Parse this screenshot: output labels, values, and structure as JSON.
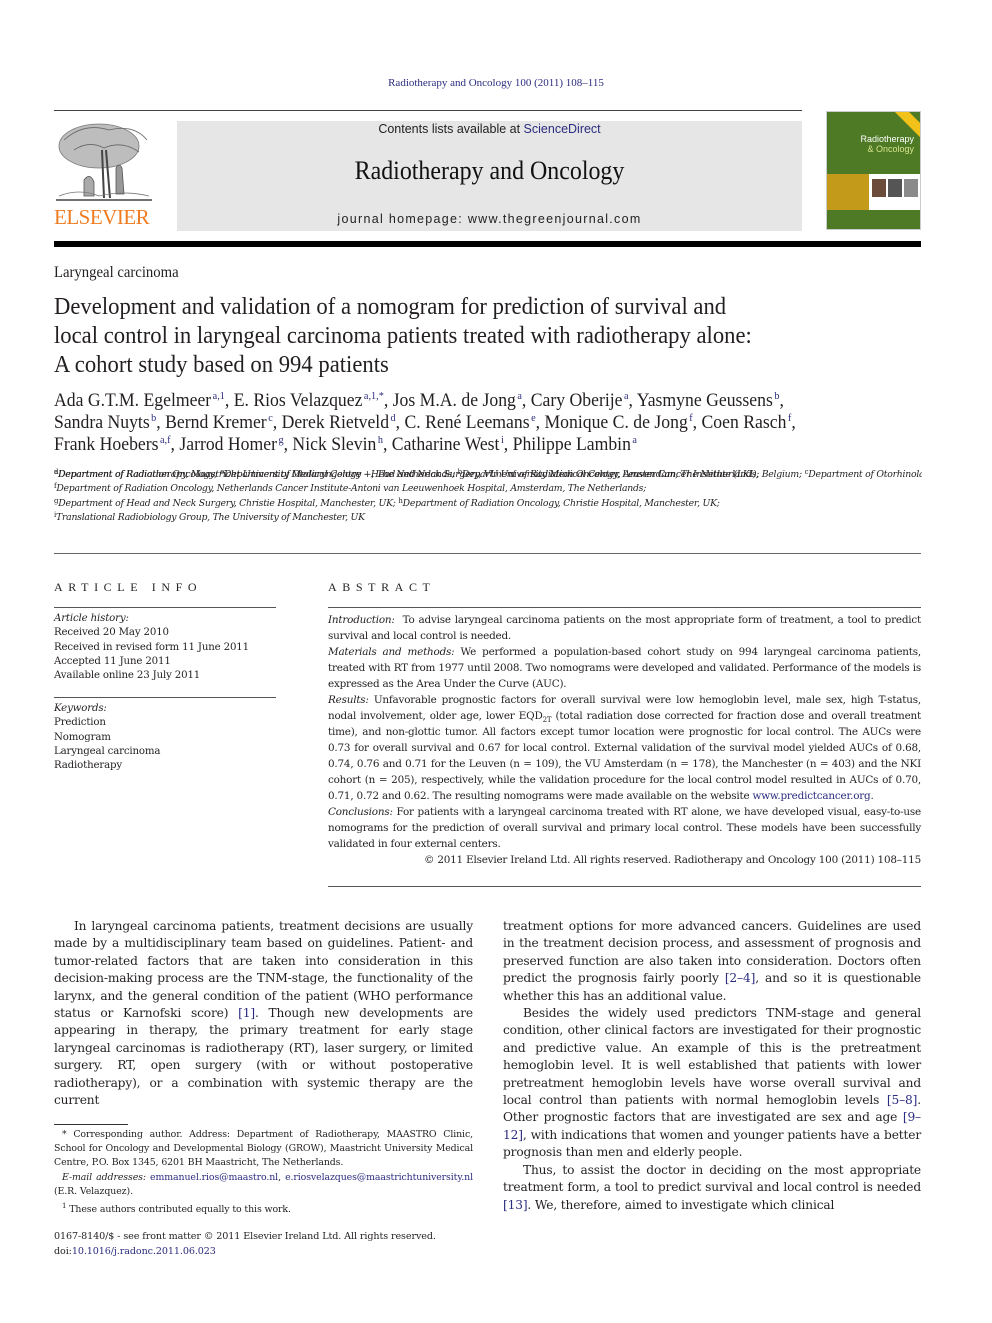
{
  "running_head": "Radiotherapy and Oncology 100 (2011) 108–115",
  "masthead": {
    "publisher_logo_text": "ELSEVIER",
    "contents_prefix": "Contents lists available at ",
    "contents_link": "ScienceDirect",
    "journal_name": "Radiotherapy and Oncology",
    "homepage_prefix": "journal homepage: ",
    "homepage_url": "www.thegreenjournal.com",
    "cover": {
      "title_line1": "Radiotherapy",
      "title_line2": "& Oncology",
      "colors": {
        "background": "#4e7a25",
        "band": "#c49a1a",
        "ribbon": "#f2c21b"
      }
    }
  },
  "colors": {
    "link": "#2b2c7f",
    "elsevier_orange": "#f07c22",
    "masthead_bg": "#e6e6e6"
  },
  "article": {
    "section": "Laryngeal carcinoma",
    "title_lines": [
      "Development and validation of a nomogram for prediction of survival and",
      "local control in laryngeal carcinoma patients treated with radiotherapy alone:",
      "A cohort study based on 994 patients"
    ],
    "authors": [
      {
        "name": "Ada G.T.M. Egelmeer",
        "sup": "a,1"
      },
      {
        "name": "E. Rios Velazquez",
        "sup": "a,1,*"
      },
      {
        "name": "Jos M.A. de Jong",
        "sup": "a"
      },
      {
        "name": "Cary Oberije",
        "sup": "a"
      },
      {
        "name": "Yasmyne Geussens",
        "sup": "b"
      },
      {
        "name": "Sandra Nuyts",
        "sup": "b"
      },
      {
        "name": "Bernd Kremer",
        "sup": "c"
      },
      {
        "name": "Derek Rietveld",
        "sup": "d"
      },
      {
        "name": "C. René Leemans",
        "sup": "e"
      },
      {
        "name": "Monique C. de Jong",
        "sup": "f"
      },
      {
        "name": "Coen Rasch",
        "sup": "f"
      },
      {
        "name": "Frank Hoebers",
        "sup": "a,f"
      },
      {
        "name": "Jarrod Homer",
        "sup": "g"
      },
      {
        "name": "Nick Slevin",
        "sup": "h"
      },
      {
        "name": "Catharine West",
        "sup": "i"
      },
      {
        "name": "Philippe Lambin",
        "sup": "a"
      }
    ],
    "affiliations": [
      {
        "key": "a",
        "text": "Department of Radiotherapy, Maastricht University Medical Centre +, The Netherlands;"
      },
      {
        "key": "b",
        "text": "Department of Radiation Oncology, Leuven Cancer Institute (LKI), Belgium;"
      },
      {
        "key": "c",
        "text": "Department of Otorhinolaryngology – Head and Neck Surgery, Maastricht University Medical Centre +, The Netherlands;"
      },
      {
        "key": "d",
        "text": "Department of Radiation Oncology;"
      },
      {
        "key": "e",
        "text": "Department of Otolaryngology – Head and Neck Surgery, VU University Medical Center, Amsterdam, The Netherlands;"
      },
      {
        "key": "f",
        "text": "Department of Radiation Oncology, Netherlands Cancer Institute-Antoni van Leeuwenhoek Hospital, Amsterdam, The Netherlands;"
      },
      {
        "key": "g",
        "text": "Department of Head and Neck Surgery, Christie Hospital, Manchester, UK;"
      },
      {
        "key": "h",
        "text": "Department of Radiation Oncology, Christie Hospital, Manchester, UK;"
      },
      {
        "key": "i",
        "text": "Translational Radiobiology Group, The University of Manchester, UK"
      }
    ]
  },
  "article_info": {
    "heading": "ARTICLE INFO",
    "history_label": "Article history:",
    "history": [
      "Received 20 May 2010",
      "Received in revised form 11 June 2011",
      "Accepted 11 June 2011",
      "Available online 23 July 2011"
    ],
    "keywords_label": "Keywords:",
    "keywords": [
      "Prediction",
      "Nomogram",
      "Laryngeal carcinoma",
      "Radiotherapy"
    ]
  },
  "abstract": {
    "heading": "ABSTRACT",
    "intro_label": "Introduction:",
    "intro": "To advise laryngeal carcinoma patients on the most appropriate form of treatment, a tool to predict survival and local control is needed.",
    "methods_label": "Materials and methods:",
    "methods": "We performed a population-based cohort study on 994 laryngeal carcinoma patients, treated with RT from 1977 until 2008. Two nomograms were developed and validated. Performance of the models is expressed as the Area Under the Curve (AUC).",
    "results_label": "Results:",
    "results_a": "Unfavorable prognostic factors for overall survival were low hemoglobin level, male sex, high T-status, nodal involvement, older age, lower EQD",
    "results_sub": "2T",
    "results_b": " (total radiation dose corrected for fraction dose and overall treatment time), and non-glottic tumor. All factors except tumor location were prognostic for local control. The AUCs were 0.73 for overall survival and 0.67 for local control. External validation of the survival model yielded AUCs of 0.68, 0.74, 0.76 and 0.71 for the Leuven (n = 109), the VU Amsterdam (n = 178), the Manchester (n = 403) and the NKI cohort (n = 205), respectively, while the validation procedure for the local control model resulted in AUCs of 0.70, 0.71, 0.72 and 0.62. The resulting nomograms were made available on the website ",
    "results_link": "www.predictcancer.org",
    "results_end": ".",
    "conclusions_label": "Conclusions:",
    "conclusions": "For patients with a laryngeal carcinoma treated with RT alone, we have developed visual, easy-to-use nomograms for the prediction of overall survival and primary local control. These models have been successfully validated in four external centers.",
    "copyright": "© 2011 Elsevier Ireland Ltd. All rights reserved. Radiotherapy and Oncology 100 (2011) 108–115"
  },
  "body": {
    "left_p1_a": "In laryngeal carcinoma patients, treatment decisions are usually made by a multidisciplinary team based on guidelines. Patient- and tumor-related factors that are taken into consideration in this decision-making process are the TNM-stage, the functionality of the larynx, and the general condition of the patient (WHO performance status or Karnofski score) ",
    "left_p1_ref": "[1]",
    "left_p1_b": ". Though new developments are appearing in therapy, the primary treatment for early stage laryngeal carcinomas is radiotherapy (RT), laser surgery, or limited surgery. RT, open surgery (with or without postoperative radiotherapy), or a combination with systemic therapy are the current",
    "right_p1_a": "treatment options for more advanced cancers. Guidelines are used in the treatment decision process, and assessment of prognosis and preserved function are also taken into consideration. Doctors often predict the prognosis fairly poorly ",
    "right_p1_ref": "[2–4]",
    "right_p1_b": ", and so it is questionable whether this has an additional value.",
    "right_p2_a": "Besides the widely used predictors TNM-stage and general condition, other clinical factors are investigated for their prognostic and predictive value. An example of this is the pretreatment hemoglobin level. It is well established that patients with lower pretreatment hemoglobin levels have worse overall survival and local control than patients with normal hemoglobin levels ",
    "right_p2_ref1": "[5–8]",
    "right_p2_b": ". Other prognostic factors that are investigated are sex and age ",
    "right_p2_ref2": "[9–12]",
    "right_p2_c": ", with indications that women and younger patients have a better prognosis than men and elderly people.",
    "right_p3_a": "Thus, to assist the doctor in deciding on the most appropriate treatment form, a tool to predict survival and local control is needed ",
    "right_p3_ref": "[13]",
    "right_p3_b": ". We, therefore, aimed to investigate which clinical"
  },
  "footnotes": {
    "corresponding": "* Corresponding author. Address: Department of Radiotherapy, MAASTRO Clinic, School for Oncology and Developmental Biology (GROW), Maastricht University Medical Centre, P.O. Box 1345, 6201 BH Maastricht, The Netherlands.",
    "email_label": "E-mail addresses:",
    "email1": "emmanuel.rios@maastro.nl",
    "email_sep": ", ",
    "email2": "e.riosvelazques@maastrichtuniversity.nl",
    "email_owner": " (E.R. Velazquez).",
    "equal_contrib_mark": "1",
    "equal_contrib": "These authors contributed equally to this work."
  },
  "issn_line": "0167-8140/$ - see front matter © 2011 Elsevier Ireland Ltd. All rights reserved.",
  "doi_prefix": "doi:",
  "doi": "10.1016/j.radonc.2011.06.023"
}
